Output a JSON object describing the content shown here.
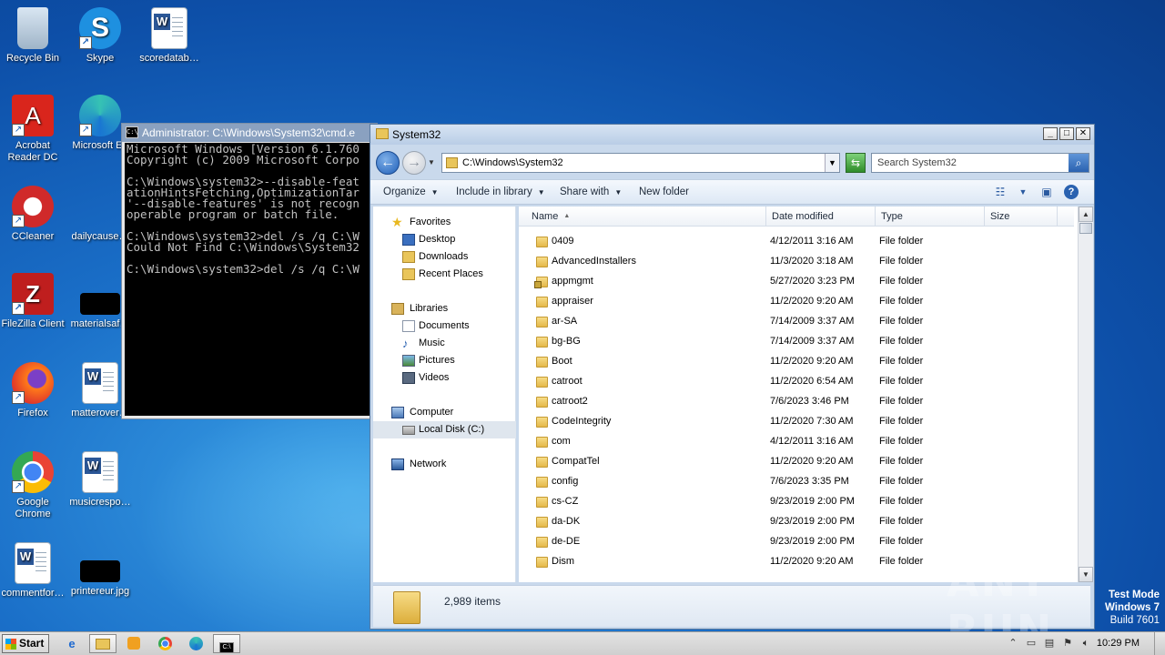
{
  "desktop": {
    "icons": [
      {
        "label": "Recycle Bin",
        "icon": "recycle-bin-icon"
      },
      {
        "label": "Skype",
        "icon": "skype-icon"
      },
      {
        "label": "scoredatab…",
        "icon": "word-document-icon"
      },
      {
        "label": "Acrobat Reader DC",
        "icon": "acrobat-icon"
      },
      {
        "label": "Microsoft Ed",
        "icon": "edge-icon"
      },
      {
        "label": "CCleaner",
        "icon": "ccleaner-icon"
      },
      {
        "label": "dailycause…",
        "icon": "blank-file-icon"
      },
      {
        "label": "FileZilla Client",
        "icon": "filezilla-icon"
      },
      {
        "label": "materialsaf…",
        "icon": "black-image-icon"
      },
      {
        "label": "Firefox",
        "icon": "firefox-icon"
      },
      {
        "label": "matterover…",
        "icon": "word-document-icon"
      },
      {
        "label": "Google Chrome",
        "icon": "chrome-icon"
      },
      {
        "label": "musicrespo…",
        "icon": "word-document-icon"
      },
      {
        "label": "commentfor…",
        "icon": "word-document-icon"
      },
      {
        "label": "printereur.jpg",
        "icon": "black-image-icon"
      }
    ]
  },
  "cmd": {
    "title": "Administrator: C:\\Windows\\System32\\cmd.e",
    "lines": [
      "Microsoft Windows [Version 6.1.760",
      "Copyright (c) 2009 Microsoft Corpo",
      "",
      "C:\\Windows\\system32>--disable-feat",
      "ationHintsFetching,OptimizationTar",
      "'--disable-features' is not recogn",
      "operable program or batch file.",
      "",
      "C:\\Windows\\system32>del /s /q C:\\W",
      "Could Not Find C:\\Windows\\System32",
      "",
      "C:\\Windows\\system32>del /s /q C:\\W"
    ]
  },
  "explorer": {
    "title": "System32",
    "address": "C:\\Windows\\System32",
    "search_placeholder": "Search System32",
    "toolbar": {
      "organize": "Organize",
      "include_in_library": "Include in library",
      "share_with": "Share with",
      "new_folder": "New folder"
    },
    "nav": {
      "favorites": "Favorites",
      "desktop": "Desktop",
      "downloads": "Downloads",
      "recent_places": "Recent Places",
      "libraries": "Libraries",
      "documents": "Documents",
      "music": "Music",
      "pictures": "Pictures",
      "videos": "Videos",
      "computer": "Computer",
      "local_disk": "Local Disk (C:)",
      "network": "Network"
    },
    "columns": {
      "name": "Name",
      "date_modified": "Date modified",
      "type": "Type",
      "size": "Size"
    },
    "rows": [
      {
        "name": "0409",
        "date": "4/12/2011 3:16 AM",
        "type": "File folder"
      },
      {
        "name": "AdvancedInstallers",
        "date": "11/3/2020 3:18 AM",
        "type": "File folder"
      },
      {
        "name": "appmgmt",
        "date": "5/27/2020 3:23 PM",
        "type": "File folder"
      },
      {
        "name": "appraiser",
        "date": "11/2/2020 9:20 AM",
        "type": "File folder"
      },
      {
        "name": "ar-SA",
        "date": "7/14/2009 3:37 AM",
        "type": "File folder"
      },
      {
        "name": "bg-BG",
        "date": "7/14/2009 3:37 AM",
        "type": "File folder"
      },
      {
        "name": "Boot",
        "date": "11/2/2020 9:20 AM",
        "type": "File folder"
      },
      {
        "name": "catroot",
        "date": "11/2/2020 6:54 AM",
        "type": "File folder"
      },
      {
        "name": "catroot2",
        "date": "7/6/2023 3:46 PM",
        "type": "File folder"
      },
      {
        "name": "CodeIntegrity",
        "date": "11/2/2020 7:30 AM",
        "type": "File folder"
      },
      {
        "name": "com",
        "date": "4/12/2011 3:16 AM",
        "type": "File folder"
      },
      {
        "name": "CompatTel",
        "date": "11/2/2020 9:20 AM",
        "type": "File folder"
      },
      {
        "name": "config",
        "date": "7/6/2023 3:35 PM",
        "type": "File folder"
      },
      {
        "name": "cs-CZ",
        "date": "9/23/2019 2:00 PM",
        "type": "File folder"
      },
      {
        "name": "da-DK",
        "date": "9/23/2019 2:00 PM",
        "type": "File folder"
      },
      {
        "name": "de-DE",
        "date": "9/23/2019 2:00 PM",
        "type": "File folder"
      },
      {
        "name": "Dism",
        "date": "11/2/2020 9:20 AM",
        "type": "File folder"
      }
    ],
    "status": "2,989 items"
  },
  "watermark": "ANY RUN",
  "test_mode": {
    "line1": "Test Mode",
    "line2": "Windows 7",
    "line3": "Build 7601"
  },
  "taskbar": {
    "start": "Start",
    "clock": "10:29 PM"
  }
}
